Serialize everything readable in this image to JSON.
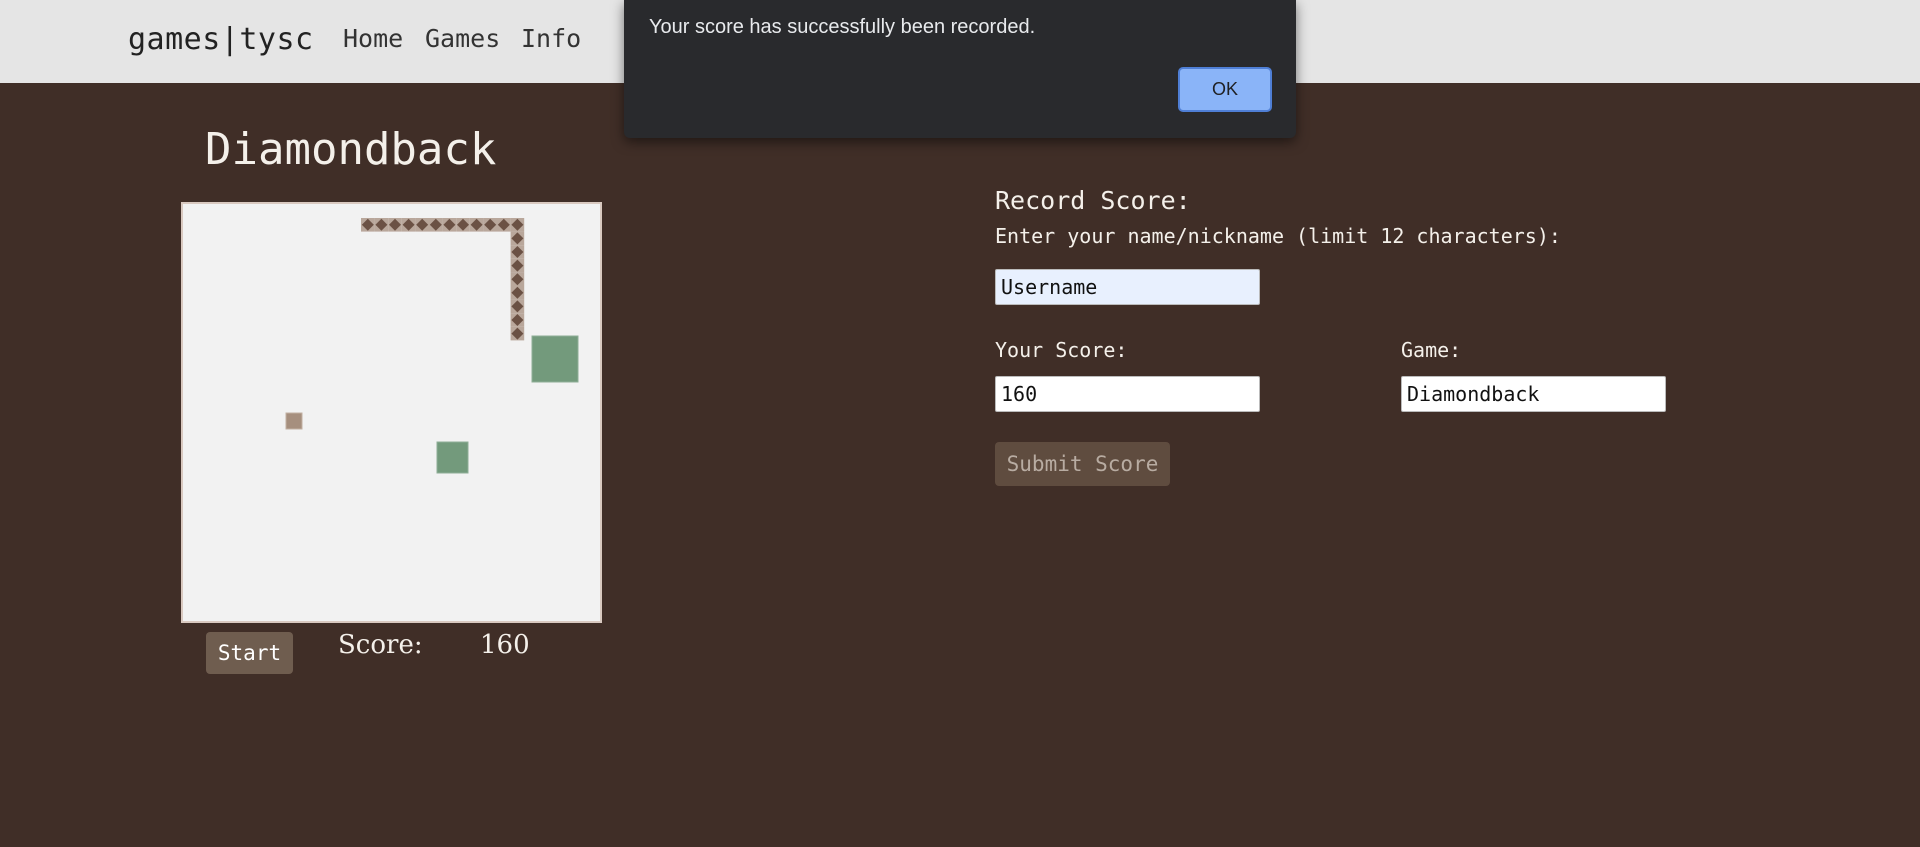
{
  "navbar": {
    "brand": "games|tysc",
    "links": [
      "Home",
      "Games",
      "Info"
    ]
  },
  "game": {
    "title": "Diamondback",
    "start_label": "Start",
    "score_label": "Score:",
    "score_value": "160",
    "board": {
      "background": "#f2f2f2",
      "snake_color": "#6b5144",
      "snake_bg": "#b9a79b",
      "food_color": "#739a7c",
      "pellet_color": "#a68f7e"
    }
  },
  "form": {
    "heading": "Record Score:",
    "name_label": "Enter your name/nickname (limit 12 characters):",
    "name_value": "Username",
    "score_label": "Your Score:",
    "score_value": "160",
    "game_label": "Game:",
    "game_value": "Diamondback",
    "submit_label": "Submit Score"
  },
  "alert": {
    "message": "Your score has successfully been recorded.",
    "ok_label": "OK"
  }
}
